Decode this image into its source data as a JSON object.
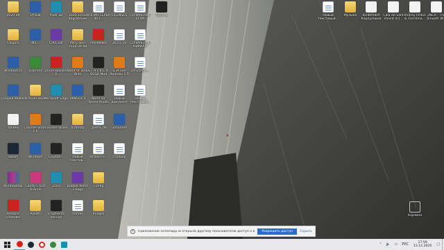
{
  "desktop": {
    "icons": [
      {
        "label": "2020.09",
        "glyph": "folder"
      },
      {
        "label": "Отзыв",
        "glyph": "app"
      },
      {
        "label": "Pixel 3D",
        "glyph": "teal"
      },
      {
        "label": "2020.10.02 Bagrateeee",
        "glyph": "folder"
      },
      {
        "label": "КОПИЯ СЕРБА 3D1...",
        "glyph": "doc"
      },
      {
        "label": "LICENSES",
        "glyph": "doc"
      },
      {
        "label": "СОЧИНЕНИЕ ЕГОР",
        "glyph": "doc"
      },
      {
        "label": "Terraria",
        "glyph": "dark"
      },
      {
        "label": "Сборка",
        "glyph": "folder"
      },
      {
        "label": "Ma...",
        "glyph": "app"
      },
      {
        "label": "CPUCoat",
        "glyph": "purple"
      },
      {
        "label": "Pony Skin 2020.09.08",
        "glyph": "folder"
      },
      {
        "label": "PlanMaker",
        "glyph": "red"
      },
      {
        "label": "26.01.19",
        "glyph": "doc"
      },
      {
        "label": "СОЧИНЕНИЕ КИРИЛЛ",
        "glyph": "doc"
      },
      {
        "label": "Windows10",
        "glyph": "app"
      },
      {
        "label": "uTorrent",
        "glyph": "green"
      },
      {
        "label": "Driver Booster 6",
        "glyph": "red"
      },
      {
        "label": "World of Tanks Blitz",
        "glyph": "orange"
      },
      {
        "label": "S.T.A.L.K.E.R. OGSR Mod",
        "glyph": "dark"
      },
      {
        "label": "GTA San Andreas 1.5",
        "glyph": "orange"
      },
      {
        "label": "Dmytrf04...",
        "glyph": "doc"
      },
      {
        "label": "Сборка Mobile",
        "glyph": "app"
      },
      {
        "label": "Pictures Book",
        "glyph": "folder"
      },
      {
        "label": "Microsoft Edge",
        "glyph": "teal"
      },
      {
        "label": "VKMusic 4",
        "glyph": "app"
      },
      {
        "label": "Need for Speed Rivals",
        "glyph": "dark"
      },
      {
        "label": "Новый документ",
        "glyph": "doc"
      },
      {
        "label": "Новый текстовый...",
        "glyph": "doc"
      },
      {
        "label": "Yandex",
        "glyph": "white"
      },
      {
        "label": "Counter-Strike 1.6",
        "glyph": "orange"
      },
      {
        "label": "Counter-Strike",
        "glyph": "dark"
      },
      {
        "label": "birthday",
        "glyph": "folder"
      },
      {
        "label": "_prefix_de",
        "glyph": "doc"
      },
      {
        "label": "unnamed",
        "glyph": "app"
      },
      {
        "label": "Steam",
        "glyph": "steam"
      },
      {
        "label": "Windows",
        "glyph": "app"
      },
      {
        "label": "Counter...",
        "glyph": "dark"
      },
      {
        "label": "Новый текстов...",
        "glyph": "doc"
      },
      {
        "label": "stickers-s...",
        "glyph": "doc"
      },
      {
        "label": "сталкер",
        "glyph": "doc"
      },
      {
        "label": "WindowsRar",
        "glyph": "rar"
      },
      {
        "label": "Candy Crush Friends",
        "glyph": "pink"
      },
      {
        "label": "Zona",
        "glyph": "teal"
      },
      {
        "label": "Bubble Witch 3 Saga",
        "glyph": "purple"
      },
      {
        "label": "Config",
        "glyph": "folder"
      },
      {
        "label": "Restorer Ultimate",
        "glyph": "red"
      },
      {
        "label": "Assets",
        "glyph": "folder"
      },
      {
        "label": "Fragments Version",
        "glyph": "dark"
      },
      {
        "label": "names",
        "glyph": "doc"
      },
      {
        "label": "Images",
        "glyph": "folder"
      },
      {
        "label": "Новый текстовый...",
        "glyph": "doc"
      },
      {
        "label": "Музыка",
        "glyph": "folder"
      },
      {
        "label": "ЮЛИАННА Карлуповна",
        "glyph": "white"
      },
      {
        "label": "Cala de Sant Vicent (Ir)...",
        "glyph": "white"
      },
      {
        "label": "Andrey Pinkin & Christina...",
        "glyph": "white"
      },
      {
        "label": "2NCA - The Smooth W...",
        "glyph": "white"
      },
      {
        "label": "Корзина",
        "glyph": "bin"
      }
    ]
  },
  "notification": {
    "message": "Приложение screenapp.io открыло другому пользователю доступ к вашему экрану",
    "allow_label": "Разрешить доступ",
    "hide_label": "Скрыть",
    "info_glyph": "!"
  },
  "taskbar": {
    "language": "РУС",
    "time": "17:59",
    "date": "13.12.2020",
    "tray_icons": [
      "chevron-up-icon",
      "speaker-icon",
      "network-icon",
      "battery-icon"
    ]
  },
  "colors": {
    "taskbar_bg": "#e9e9ec",
    "allow_button": "#2d6ac9"
  }
}
